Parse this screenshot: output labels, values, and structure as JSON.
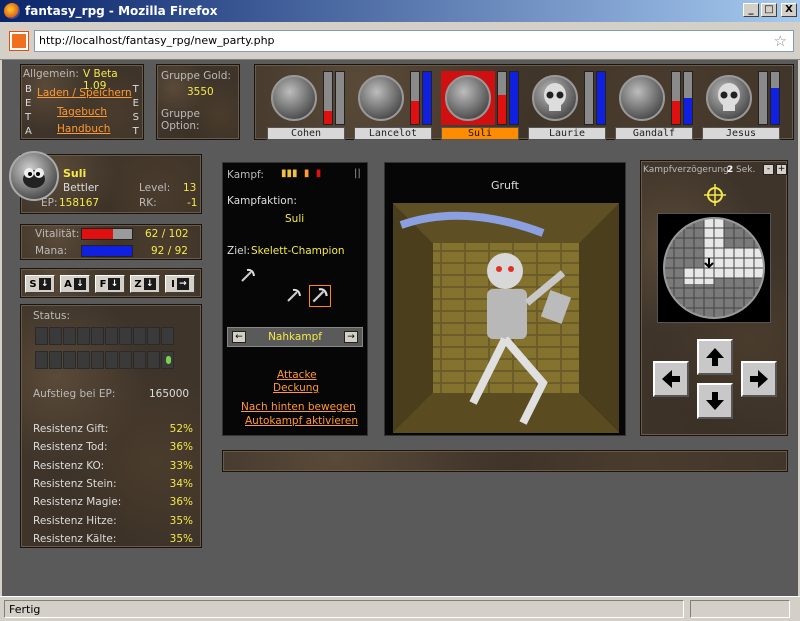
{
  "window": {
    "title": "fantasy_rpg - Mozilla Firefox",
    "minimize": "_",
    "maximize": "□",
    "close": "X"
  },
  "address": {
    "url": "http://localhost/fantasy_rpg/new_party.php"
  },
  "statusbar": {
    "text": "Fertig"
  },
  "info": {
    "allgemein_label": "Allgemein:",
    "version": "V Beta 1.09",
    "beta_left": [
      "B",
      "E",
      "T",
      "A"
    ],
    "test_right": [
      "T",
      "E",
      "S",
      "T"
    ],
    "links": [
      "Laden / Speichern",
      "Tagebuch",
      "Handbuch"
    ]
  },
  "group": {
    "gold_label": "Gruppe Gold:",
    "gold_value": "3550",
    "option_label": "Gruppe Option:"
  },
  "party": [
    {
      "name": "Cohen",
      "hp": 0.25,
      "mp": 0.0,
      "selected": false,
      "icon": "viking-helmet-axe-icon"
    },
    {
      "name": "Lancelot",
      "hp": 0.45,
      "mp": 1.0,
      "selected": false,
      "icon": "crusader-shield-sword-icon"
    },
    {
      "name": "Suli",
      "hp": 0.55,
      "mp": 1.0,
      "selected": true,
      "icon": "thief-rat-icon"
    },
    {
      "name": "Laurie",
      "hp": 0.0,
      "mp": 1.0,
      "selected": false,
      "icon": "skull-icon"
    },
    {
      "name": "Gandalf",
      "hp": 0.45,
      "mp": 0.5,
      "selected": false,
      "icon": "wizard-staff-icon"
    },
    {
      "name": "Jesus",
      "hp": 0.0,
      "mp": 0.7,
      "selected": false,
      "icon": "skull-icon"
    }
  ],
  "character": {
    "name": "Suli",
    "class": "Bettler",
    "level_label": "Level:",
    "level": "13",
    "ep_label": "EP:",
    "ep": "158167",
    "rk_label": "RK:",
    "rk": "-1",
    "vitality_label": "Vitalität:",
    "vitality": "62 / 102",
    "vitality_frac": 0.61,
    "mana_label": "Mana:",
    "mana": "92 / 92",
    "mana_frac": 1.0
  },
  "hotkeys": [
    {
      "key": "S",
      "arrow": "↓"
    },
    {
      "key": "A",
      "arrow": "↓"
    },
    {
      "key": "F",
      "arrow": "↓"
    },
    {
      "key": "Z",
      "arrow": "↓"
    },
    {
      "key": "I",
      "arrow": "→"
    }
  ],
  "stats": {
    "status_label": "Status:",
    "ascend_label": "Aufstieg bei EP:",
    "ascend_value": "165000",
    "resist": [
      {
        "label": "Resistenz Gift:",
        "value": "52%"
      },
      {
        "label": "Resistenz Tod:",
        "value": "36%"
      },
      {
        "label": "Resistenz KO:",
        "value": "33%"
      },
      {
        "label": "Resistenz Stein:",
        "value": "34%"
      },
      {
        "label": "Resistenz Magie:",
        "value": "36%"
      },
      {
        "label": "Resistenz Hitze:",
        "value": "35%"
      },
      {
        "label": "Resistenz Kälte:",
        "value": "35%"
      }
    ]
  },
  "combat": {
    "kampf_label": "Kampf:",
    "pause_icon": "||",
    "faction_label": "Kampfaktion:",
    "faction_value": "Suli",
    "target_label": "Ziel:",
    "target_value": "Skelett-Champion",
    "mode": "Nahkampf",
    "prev": "←",
    "next": "→",
    "actions": [
      "Attacke",
      "Deckung",
      "Nach hinten bewegen",
      "Autokampf aktivieren"
    ]
  },
  "scene": {
    "location": "Gruft"
  },
  "nav": {
    "delay_label": "Kampfverzögerung:",
    "delay_value": "2",
    "delay_unit": "Sek.",
    "minus": "-",
    "plus": "+",
    "up": "↑",
    "down": "↓",
    "left": "←",
    "right": "→",
    "colors": {
      "bar_red": "#e01010",
      "bar_blue": "#1020e0",
      "selected": "#ff8c00",
      "link": "#ff9933",
      "value": "#f4e94a"
    }
  }
}
